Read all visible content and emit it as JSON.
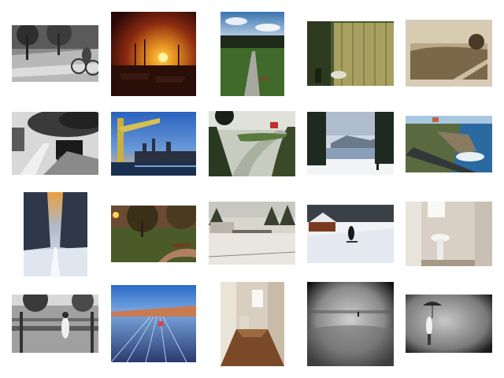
{
  "gallery": {
    "rows": 4,
    "columns": 5,
    "background": "#ffffff",
    "photos": [
      {
        "subject": "cyclist-bw-park-photo"
      },
      {
        "subject": "harbor-sunset-photo"
      },
      {
        "subject": "forest-path-bench-photo"
      },
      {
        "subject": "bathroom-shower-curtain-photo"
      },
      {
        "subject": "sepia-railway-landscape-photo"
      },
      {
        "subject": "steam-locomotive-station-photo"
      },
      {
        "subject": "diving-tower-city-skyline-photo"
      },
      {
        "subject": "river-valley-overlook-photo"
      },
      {
        "subject": "snowy-lake-pine-forest-photo"
      },
      {
        "subject": "coastal-railway-cliff-photo"
      },
      {
        "subject": "snowy-forest-sunbeam-photo"
      },
      {
        "subject": "park-lamp-bench-dusk-photo"
      },
      {
        "subject": "vintage-snowy-lodge-photo"
      },
      {
        "subject": "snowboarder-cabin-slope-photo"
      },
      {
        "subject": "bathroom-sink-corner-photo"
      },
      {
        "subject": "child-balance-beam-bw-photo"
      },
      {
        "subject": "rail-yard-dusk-photo"
      },
      {
        "subject": "hallway-wood-floor-photo"
      },
      {
        "subject": "beach-vignette-bw-photo"
      },
      {
        "subject": "person-umbrella-mist-photo"
      }
    ]
  }
}
